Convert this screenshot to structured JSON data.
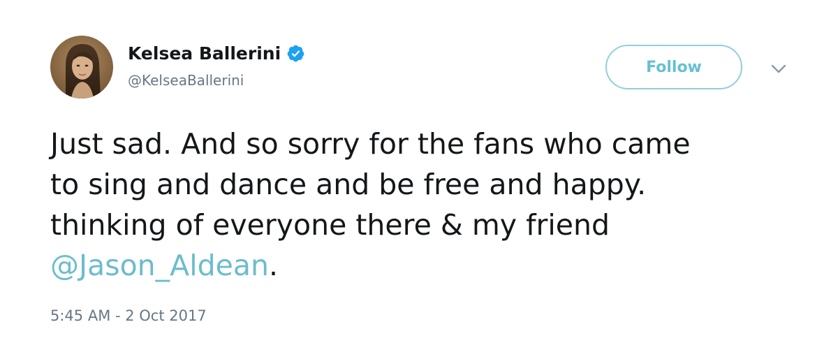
{
  "author": {
    "display_name": "Kelsea Ballerini",
    "handle": "@KelseaBallerini",
    "verified": true,
    "avatar_icon": "profile-photo"
  },
  "follow_button": {
    "label": "Follow"
  },
  "menu": {
    "icon": "chevron-down-icon"
  },
  "tweet": {
    "line1": "Just sad. And so sorry for the fans who came",
    "line2": "to sing and dance and be free and happy.",
    "line3": "thinking of everyone there & my friend",
    "mention": "@Jason_Aldean",
    "trailing": "."
  },
  "timestamp": "5:45 AM - 2 Oct 2017",
  "colors": {
    "link": "#6cbccd",
    "verified": "#1da1f2",
    "button_border": "#8ed0dd",
    "secondary_text": "#657786"
  }
}
